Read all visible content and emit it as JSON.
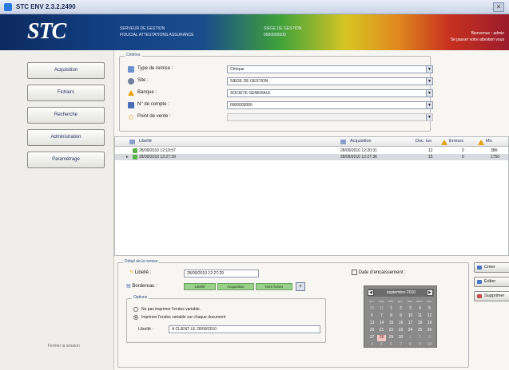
{
  "window": {
    "title": "STC ENV 2.3.2.2490",
    "close_label": "×"
  },
  "banner": {
    "logo": "STC",
    "info_left": [
      "SERVEUR DE GESTION",
      "FIDUCIAL ATTESTATIONS ASSURANCE"
    ],
    "info_mid": [
      "SIEGE DE GESTION",
      "0000000000"
    ],
    "info_right": [
      "Bienvenue : admin",
      "Se passer votre attestion vous"
    ]
  },
  "sidebar": {
    "items": [
      {
        "label": "Acquisition"
      },
      {
        "label": "Fichiers"
      },
      {
        "label": "Recherche"
      },
      {
        "label": "Administration"
      },
      {
        "label": "Paramétrage"
      }
    ],
    "footer": "Fermer la session"
  },
  "criteria": {
    "title": "Critères",
    "fields": [
      {
        "label": "Type de remise :",
        "value": "Chèque",
        "icon": "document-icon",
        "color": "#6b8fcf"
      },
      {
        "label": "Site :",
        "value": "SIEGE DE GESTION",
        "icon": "people-icon",
        "color": "#6f7f99"
      },
      {
        "label": "Banque :",
        "value": "SOCIETE GENERALE",
        "icon": "warning-icon",
        "color": "#e7a30f"
      },
      {
        "label": "N° de compte :",
        "value": "0000000000",
        "icon": "book-icon",
        "color": "#4a6fb8"
      },
      {
        "label": "Point de vente :",
        "value": "",
        "icon": "star-icon",
        "color": "#d99a1c"
      }
    ]
  },
  "grid": {
    "columns": [
      "Libellé",
      "Acquisition",
      "Doc. lus",
      "Erreurs",
      "Mo"
    ],
    "rows": [
      {
        "label": "28/09/2010 12:19:57",
        "acquisition": "28/09/2010 12:20:31",
        "docs": "12",
        "errors": "0",
        "mo": "38K"
      },
      {
        "label": "28/09/2010 12:27:29",
        "acquisition": "28/09/2010 12:27:36",
        "docs": "15",
        "errors": "0",
        "mo": "1750"
      }
    ]
  },
  "detail": {
    "title": "Détail de la remise",
    "libelle_label": "Libellé :",
    "libelle_value": "28/09/2010 12:27:29",
    "bordereau_label": "Bordereau :",
    "tags": [
      "Libellé",
      "Acquisition",
      "Nom fichier"
    ],
    "add_label": "+",
    "options": {
      "title": "Options",
      "opt1": "Ne pas imprimer l'endos variable.",
      "opt2": "Imprimer l'endos variable sur chaque document",
      "libelle_label": "Libellé :",
      "libelle_value": "A CLIENT LE 28/09/2010"
    },
    "date_label": "Date d'encaissement :",
    "calendar": {
      "month": "septembre 2010",
      "days_header": [
        "lun.",
        "mar.",
        "mer.",
        "jeu.",
        "ven.",
        "sam.",
        "dim."
      ],
      "weeks": [
        [
          "30",
          "31",
          "1",
          "2",
          "3",
          "4",
          "5"
        ],
        [
          "6",
          "7",
          "8",
          "9",
          "10",
          "11",
          "12"
        ],
        [
          "13",
          "14",
          "15",
          "16",
          "17",
          "18",
          "19"
        ],
        [
          "20",
          "21",
          "22",
          "23",
          "24",
          "25",
          "26"
        ],
        [
          "27",
          "28",
          "29",
          "30",
          "1",
          "2",
          "3"
        ],
        [
          "4",
          "5",
          "6",
          "7",
          "8",
          "9",
          "10"
        ]
      ],
      "selected": "28"
    }
  },
  "actions": {
    "create": "Créer",
    "edit": "Éditer",
    "delete": "Supprimer"
  }
}
